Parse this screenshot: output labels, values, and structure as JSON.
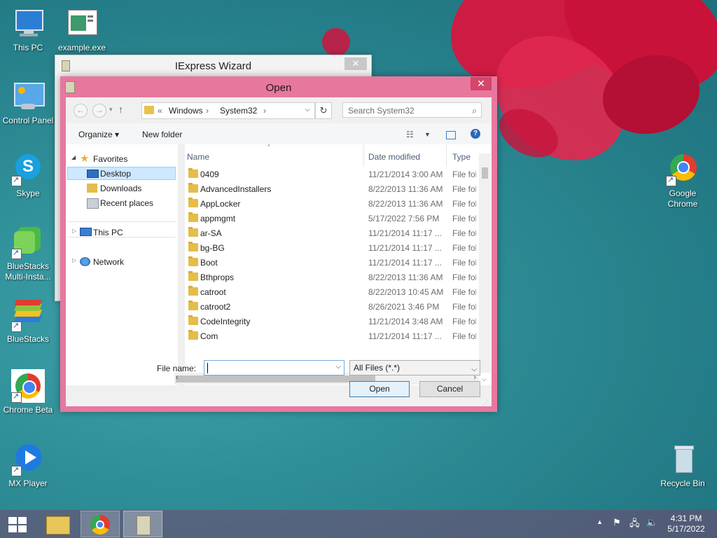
{
  "desktop": {
    "icons": [
      {
        "label": "This PC"
      },
      {
        "label": "example.exe"
      },
      {
        "label": "Control Panel"
      },
      {
        "label": "Skype"
      },
      {
        "label": "BlueStacks Multi-Insta..."
      },
      {
        "label": "BlueStacks"
      },
      {
        "label": "Chrome Beta"
      },
      {
        "label": "MX Player"
      },
      {
        "label": "Google Chrome"
      },
      {
        "label": "Recycle Bin"
      }
    ]
  },
  "iexpress_window": {
    "title": "IExpress Wizard",
    "close": "✕"
  },
  "open_dialog": {
    "title": "Open",
    "close": "✕",
    "address": {
      "prefix": "«",
      "crumbs": [
        "Windows",
        "System32"
      ],
      "separator": "›"
    },
    "search_placeholder": "Search System32",
    "toolbar": {
      "organize": "Organize ▾",
      "new_folder": "New folder"
    },
    "nav": {
      "favorites": "Favorites",
      "desktop": "Desktop",
      "downloads": "Downloads",
      "recent": "Recent places",
      "this_pc": "This PC",
      "network": "Network"
    },
    "columns": {
      "name": "Name",
      "date": "Date modified",
      "type": "Type"
    },
    "rows": [
      {
        "name": "0409",
        "date": "11/21/2014 3:00 AM",
        "type": "File fol"
      },
      {
        "name": "AdvancedInstallers",
        "date": "8/22/2013 11:36 AM",
        "type": "File fol"
      },
      {
        "name": "AppLocker",
        "date": "8/22/2013 11:36 AM",
        "type": "File fol"
      },
      {
        "name": "appmgmt",
        "date": "5/17/2022 7:56 PM",
        "type": "File fol"
      },
      {
        "name": "ar-SA",
        "date": "11/21/2014 11:17 ...",
        "type": "File fol"
      },
      {
        "name": "bg-BG",
        "date": "11/21/2014 11:17 ...",
        "type": "File fol"
      },
      {
        "name": "Boot",
        "date": "11/21/2014 11:17 ...",
        "type": "File fol"
      },
      {
        "name": "Bthprops",
        "date": "8/22/2013 11:36 AM",
        "type": "File fol"
      },
      {
        "name": "catroot",
        "date": "8/22/2013 10:45 AM",
        "type": "File fol"
      },
      {
        "name": "catroot2",
        "date": "8/26/2021 3:46 PM",
        "type": "File fol"
      },
      {
        "name": "CodeIntegrity",
        "date": "11/21/2014 3:48 AM",
        "type": "File fol"
      },
      {
        "name": "Com",
        "date": "11/21/2014 11:17 ...",
        "type": "File fol"
      }
    ],
    "file_name_label": "File name:",
    "file_name_value": "",
    "file_type": "All Files (*.*)",
    "open_button": "Open",
    "cancel_button": "Cancel"
  },
  "taskbar": {
    "time": "4:31 PM",
    "date": "5/17/2022"
  },
  "colors": {
    "dialog_frame": "#e8779e",
    "close_button": "#d4466a",
    "selection": "#cde8ff"
  }
}
